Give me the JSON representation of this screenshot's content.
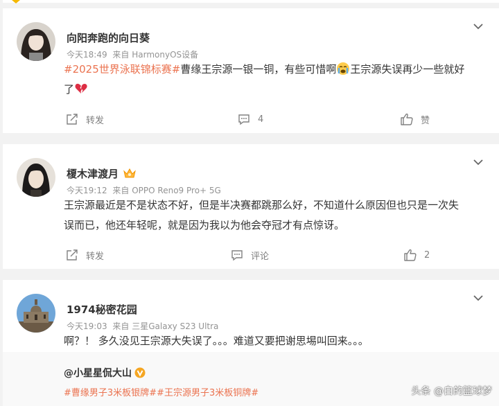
{
  "posts": [
    {
      "username": "向阳奔跑的向日葵",
      "time": "今天18:49",
      "source": "来自 HarmonyOS设备",
      "topic": "#2025世界泳联锦标赛#",
      "text_a": "曹缘王宗源一银一铜，有些可惜啊",
      "text_b": "王宗源失误再少一些就好",
      "text_c": "了",
      "repost_label": "转发",
      "comment_count": "4",
      "like_label": "赞"
    },
    {
      "username": "榎木津渡月",
      "time": "今天19:12",
      "source": "来自 OPPO Reno9 Pro+ 5G",
      "line1": "王宗源最近是不是状态不好，但是半决赛都跳那么好，不知道什么原因但也只是一次失",
      "line2": "误而已，他还年轻呢，就是因为我以为他会夺冠才有点惊讶。",
      "repost_label": "转发",
      "comment_label": "评论",
      "like_count": "2"
    },
    {
      "username": "1974秘密花园",
      "time": "今天19:03",
      "source": "来自 三星Galaxy S23 Ultra",
      "text": "啊？！ 多久没见王宗源大失误了。。。难道又要把谢思埸叫回来。。。",
      "repost": {
        "username": "@小星星侃大山",
        "topics": "#曹缘男子3米板银牌##王宗源男子3米板铜牌#"
      }
    }
  ],
  "watermark": "头条 @白的篮球梦",
  "colors": {
    "topic": "#eb7350",
    "meta": "#939393",
    "background": "#f2f2f2"
  }
}
